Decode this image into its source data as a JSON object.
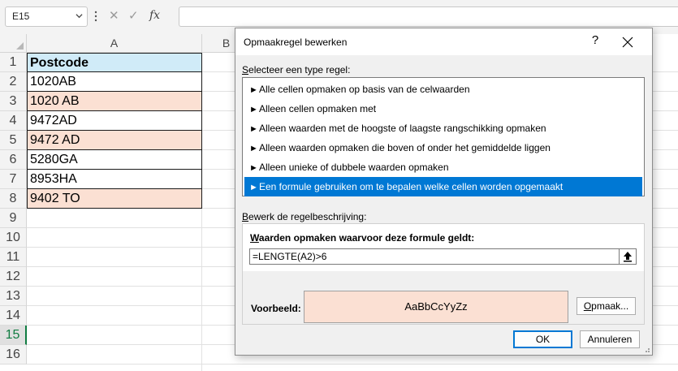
{
  "formula_bar": {
    "name_box": "E15",
    "cancel_glyph": "✕",
    "enter_glyph": "✓",
    "fx_glyph": "fx",
    "formula": ""
  },
  "sheet": {
    "columns": [
      "A",
      "B"
    ],
    "rows": [
      "1",
      "2",
      "3",
      "4",
      "5",
      "6",
      "7",
      "8",
      "9",
      "10",
      "11",
      "12",
      "13",
      "14",
      "15",
      "16"
    ],
    "selected_row": "15",
    "cells": [
      "Postcode",
      "1020AB",
      "1020 AB",
      "9472AD",
      "9472 AD",
      "5280GA",
      "8953HA",
      "9402 TO"
    ]
  },
  "dialog": {
    "title": "Opmaakregel bewerken",
    "help": "?",
    "select_rule_type_label": "Selecteer een type regel:",
    "select_rule_type_underline": "S",
    "select_rule_type_rest": "electeer een type regel:",
    "rule_types": [
      "Alle cellen opmaken op basis van de celwaarden",
      "Alleen cellen opmaken met",
      "Alleen waarden met de hoogste of laagste rangschikking opmaken",
      "Alleen waarden opmaken die boven of onder het gemiddelde liggen",
      "Alleen unieke of dubbele waarden opmaken",
      "Een formule gebruiken om te bepalen welke cellen worden opgemaakt"
    ],
    "selected_rule_index": 5,
    "edit_desc_underline": "B",
    "edit_desc_rest": "ewerk de regelbeschrijving:",
    "formula_label_underline": "W",
    "formula_label_rest": "aarden opmaken waarvoor deze formule geldt:",
    "formula_value": "=LENGTE(A2)>6",
    "preview_label": "Voorbeeld:",
    "preview_text": "AaBbCcYyZz",
    "format_button_underline": "O",
    "format_button_rest": "pmaak...",
    "ok_label": "OK",
    "cancel_label": "Annuleren"
  },
  "colors": {
    "header_fill": "#d0ebf8",
    "highlight_fill": "#fbe0d3",
    "selection_blue": "#0078d4",
    "excel_green": "#107c41"
  }
}
